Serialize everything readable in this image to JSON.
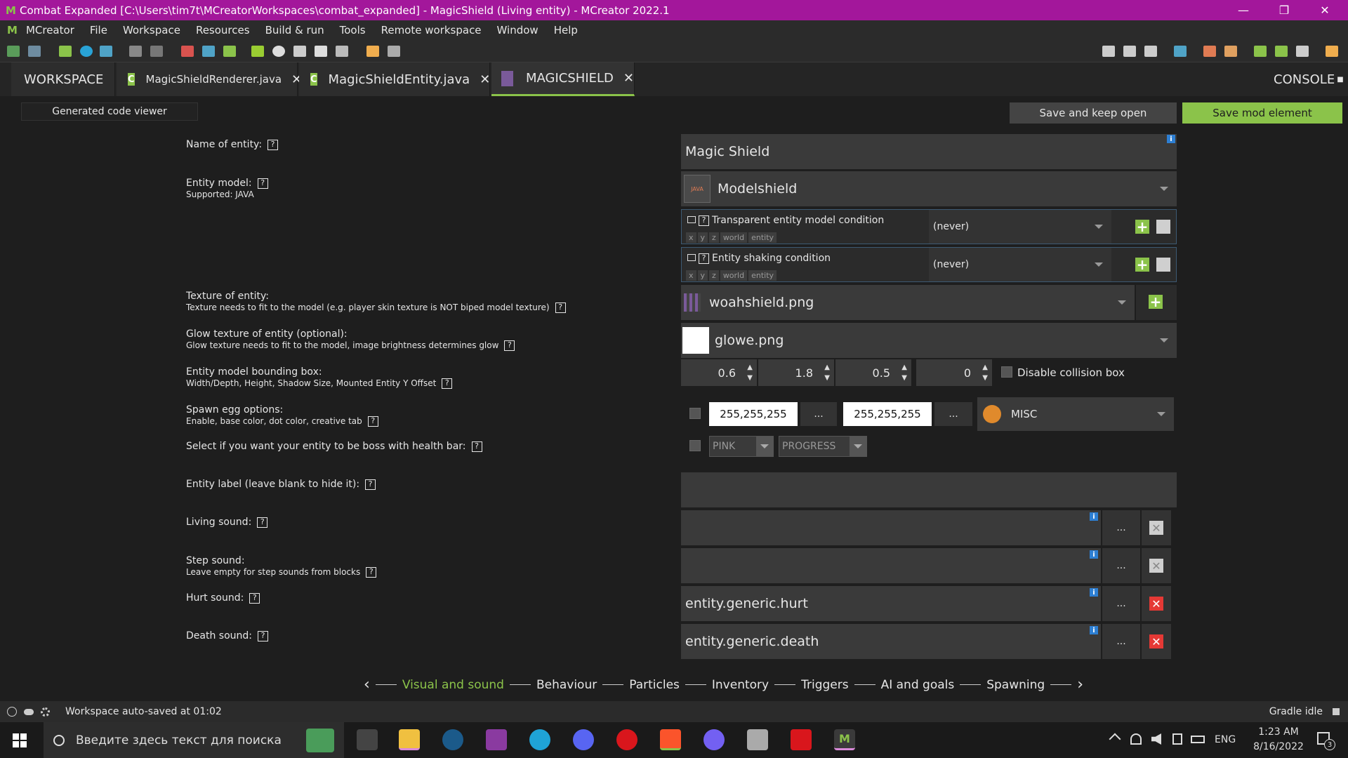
{
  "window": {
    "title": "Combat Expanded [C:\\Users\\tim7t\\MCreatorWorkspaces\\combat_expanded] - MagicShield (Living entity) - MCreator 2022.1",
    "minimize": "—",
    "restore": "❐",
    "close": "✕"
  },
  "menu": [
    "MCreator",
    "File",
    "Workspace",
    "Resources",
    "Build & run",
    "Tools",
    "Remote workspace",
    "Window",
    "Help"
  ],
  "tabs": {
    "workspace": "WORKSPACE",
    "renderer": "MagicShieldRenderer.java",
    "entity": "MagicShieldEntity.java",
    "current": "MAGICSHIELD",
    "console": "CONSOLE",
    "close": "✕",
    "java_icon": "C"
  },
  "buttons": {
    "code_viewer": "Generated code viewer",
    "save_keep": "Save and keep open",
    "save_mod": "Save mod element"
  },
  "labels": {
    "name": "Name of entity:",
    "model": "Entity model:",
    "model_sub": "Supported: JAVA",
    "texture": "Texture of entity:",
    "texture_sub": "Texture needs to fit to the model (e.g. player skin texture is NOT biped model texture)",
    "glow": "Glow texture of entity (optional):",
    "glow_sub": "Glow texture needs to fit to the model, image brightness determines glow",
    "bbox": "Entity model bounding box:",
    "bbox_sub": "Width/Depth, Height, Shadow Size, Mounted Entity Y Offset",
    "spawn": "Spawn egg options:",
    "spawn_sub": "Enable, base color, dot color, creative tab",
    "boss": "Select if you want your entity to be boss with health bar:",
    "label": "Entity label (leave blank to hide it):",
    "living": "Living sound:",
    "step": "Step sound:",
    "step_sub": "Leave empty for step sounds from blocks",
    "hurt": "Hurt sound:",
    "death": "Death sound:",
    "q": "?"
  },
  "fields": {
    "name": "Magic Shield",
    "model": "Modelshield",
    "model_icon_text": "JAVA",
    "transparent_cond": "Transparent entity model condition",
    "shaking_cond": "Entity shaking condition",
    "cond_value": "(never)",
    "cond_tags": [
      "x",
      "y",
      "z",
      "world",
      "entity"
    ],
    "texture": "woahshield.png",
    "glow": "glowe.png",
    "bbox": [
      "0.6",
      "1.8",
      "0.5",
      "0"
    ],
    "spinner_arrows": "▲\n▼",
    "disable_collision": "Disable collision box",
    "base_color": "255,255,255",
    "dot_color": "255,255,255",
    "dots": "...",
    "creative_tab": "MISC",
    "boss_color": "PINK",
    "boss_style": "PROGRESS",
    "entity_label": "",
    "living_sound": "",
    "step_sound": "",
    "hurt_sound": "entity.generic.hurt",
    "death_sound": "entity.generic.death",
    "info": "i",
    "plus": "+",
    "xmark": "✕"
  },
  "nav": {
    "prev": "‹",
    "next": "›",
    "pages": [
      "Visual and sound",
      "Behaviour",
      "Particles",
      "Inventory",
      "Triggers",
      "AI and goals",
      "Spawning"
    ]
  },
  "status": {
    "text": "Workspace auto-saved at 01:02",
    "gradle": "Gradle idle"
  },
  "taskbar": {
    "search": "Введите здесь текст для поиска",
    "time": "1:23 AM",
    "date": "8/16/2022",
    "lang": "ENG",
    "notif": "3"
  },
  "colors": {
    "titlebar": "#a3179b",
    "accent": "#8bc34a",
    "bg": "#1e1e1e"
  }
}
